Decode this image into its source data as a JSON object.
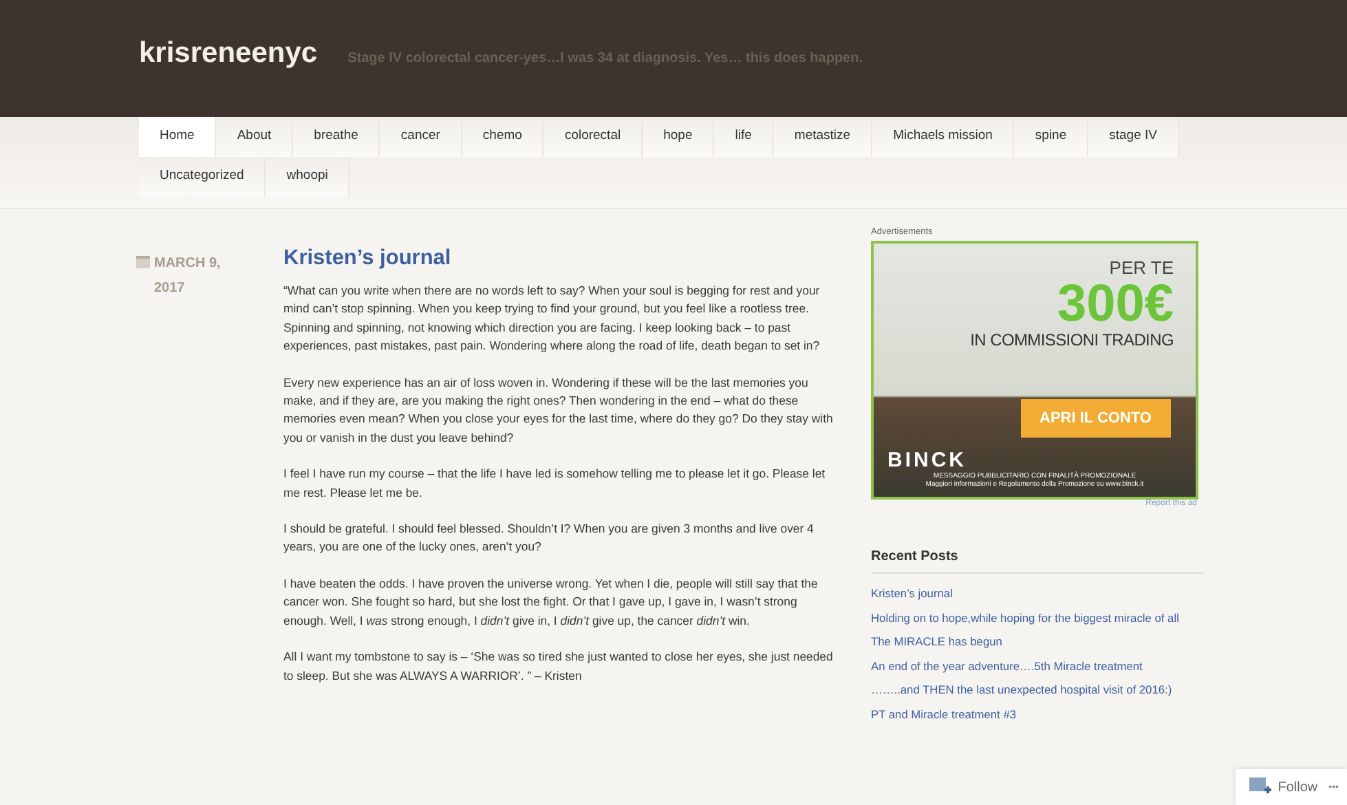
{
  "site": {
    "title": "krisreneenyc",
    "tagline": "Stage IV colorectal cancer-yes…I was 34 at diagnosis. Yes… this does happen."
  },
  "nav": [
    {
      "label": "Home",
      "selected": true
    },
    {
      "label": "About",
      "selected": false
    },
    {
      "label": "breathe",
      "selected": false
    },
    {
      "label": "cancer",
      "selected": false
    },
    {
      "label": "chemo",
      "selected": false
    },
    {
      "label": "colorectal",
      "selected": false
    },
    {
      "label": "hope",
      "selected": false
    },
    {
      "label": "life",
      "selected": false
    },
    {
      "label": "metastize",
      "selected": false
    },
    {
      "label": "Michaels mission",
      "selected": false
    },
    {
      "label": "spine",
      "selected": false
    },
    {
      "label": "stage IV",
      "selected": false
    },
    {
      "label": "Uncategorized",
      "selected": false
    },
    {
      "label": "whoopi",
      "selected": false
    }
  ],
  "post": {
    "date": "MARCH 9, 2017",
    "title": "Kristen’s journal",
    "paragraphs": [
      "“What can you write when there are no words left to say? When your soul is begging for rest and your mind can’t stop spinning. When you keep trying to find your ground, but you feel like a rootless tree. Spinning and spinning, not knowing which direction you are facing. I keep looking back – to past experiences, past mistakes, past pain. Wondering where along the road of life, death began to set in?",
      "Every new experience has an air of loss woven in. Wondering if these will be the last memories you make, and if they are, are you making the right ones? Then wondering in the end – what do these memories even mean? When you close your eyes for the last time, where do they go? Do they stay with you or vanish in the dust you leave behind?",
      "I feel I have run my course – that the life I have led is somehow telling me to please let it go. Please let me rest. Please let me be.",
      "I should be grateful. I should feel blessed. Shouldn’t I? When you are given 3 months and live over 4 years, you are one of the lucky ones, aren’t you?",
      "I have beaten the odds. I have proven the universe wrong. Yet when I die, people will still say that the cancer won. She fought so hard, but she lost the fight. Or that I gave up, I gave in, I wasn’t strong enough. Well, I *was* strong enough, I *didn’t* give in, I *didn’t* give up, the cancer *didn’t* win.",
      " All I want my tombstone to say is – ‘She was so tired she just wanted to close her eyes, she just needed to sleep. But she was ALWAYS A WARRIOR’. ” – Kristen"
    ]
  },
  "sidebar": {
    "ad_label": "Advertisements",
    "ad": {
      "headline": "PER TE",
      "amount": "300€",
      "subline": "IN COMMISSIONI TRADING",
      "cta": "APRI IL CONTO",
      "brand": "BINCK",
      "disclaimer_1": "MESSAGGIO PUBBLICITARIO CON FINALITÀ PROMOZIONALE",
      "disclaimer_2": "Maggiori informazioni e Regolamento della Promozione su www.binck.it"
    },
    "report": "Report this ad",
    "recent_title": "Recent Posts",
    "recent": [
      "Kristen’s journal",
      "Holding on to hope,while hoping for the biggest miracle of all",
      "The MIRACLE has begun",
      "An end of the year adventure….5th Miracle treatment",
      "……..and THEN the last unexpected hospital visit of 2016:)",
      "PT and Miracle treatment #3"
    ]
  },
  "follow": {
    "label": "Follow",
    "more": "•••"
  }
}
